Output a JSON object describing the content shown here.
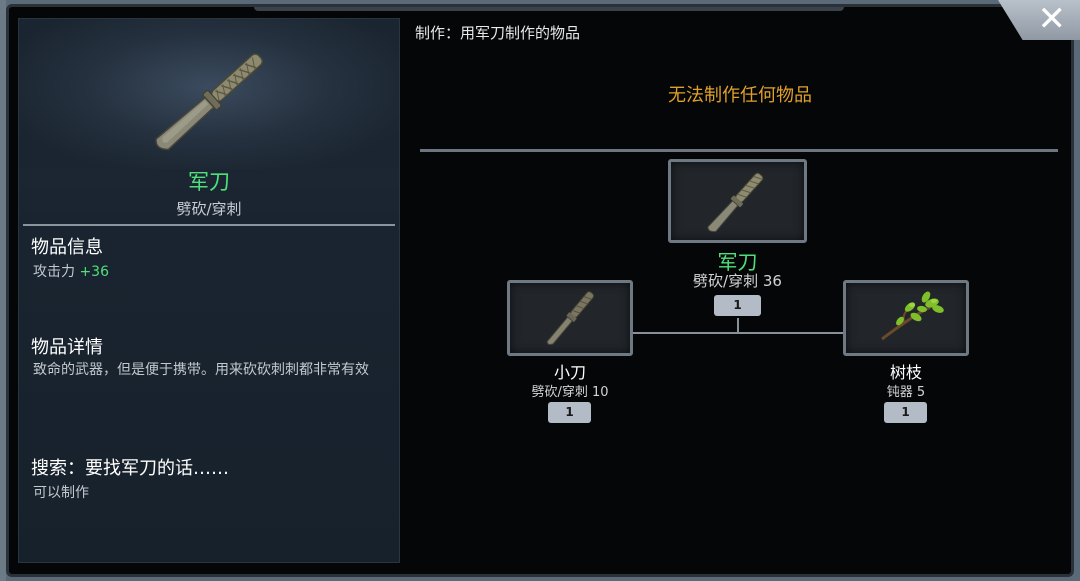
{
  "close_glyph": "✕",
  "item": {
    "name": "军刀",
    "type": "劈砍/穿刺",
    "info_title": "物品信息",
    "attack_label": "攻击力",
    "attack_value": "+36",
    "details_title": "物品详情",
    "details_text": "致命的武器，但是便于携带。用来砍砍刺刺都非常有效",
    "search_title": "搜索：要找军刀的话……",
    "search_text": "可以制作"
  },
  "craft": {
    "header": "制作：用军刀制作的物品",
    "empty_message": "无法制作任何物品"
  },
  "recipe": {
    "result": {
      "name": "军刀",
      "stat": "劈砍/穿刺 36",
      "count": "1",
      "icon": "military-knife-icon"
    },
    "ingredients": [
      {
        "name": "小刀",
        "stat": "劈砍/穿刺 10",
        "count": "1",
        "icon": "small-knife-icon"
      },
      {
        "name": "树枝",
        "stat": "钝器 5",
        "count": "1",
        "icon": "branch-icon"
      }
    ]
  },
  "colors": {
    "item_name": "#4fe07a",
    "attack_value": "#4fe07a",
    "empty_message": "#e0a02a"
  }
}
